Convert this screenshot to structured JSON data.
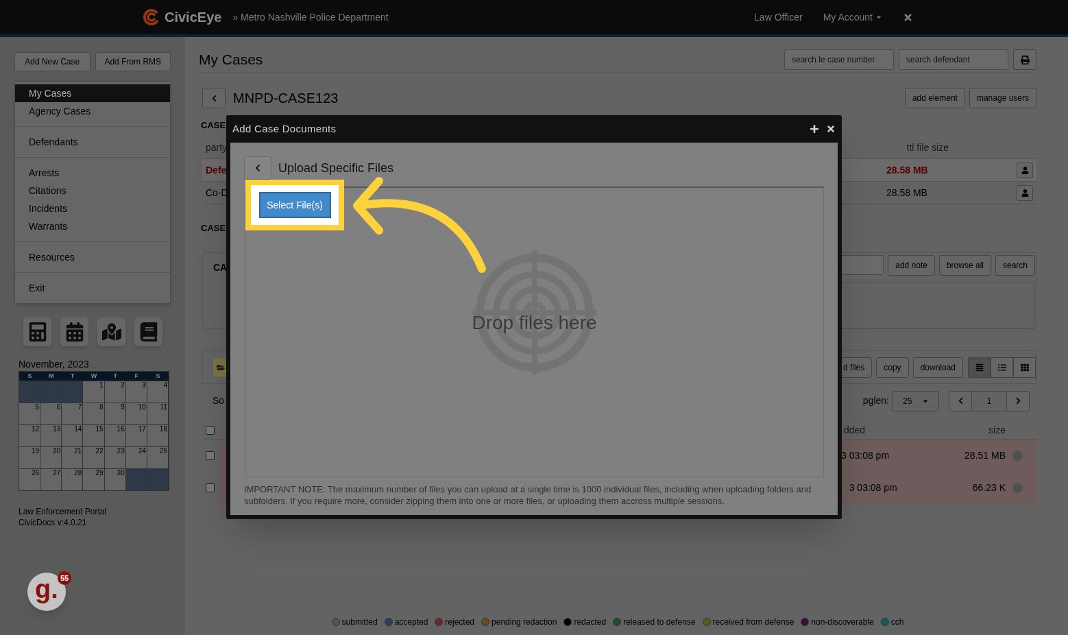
{
  "nav": {
    "brand": "CivicEye",
    "agency": "» Metro Nashville Police Department",
    "links": [
      {
        "label": "Law Officer",
        "kind": "link"
      },
      {
        "label": "My Account",
        "kind": "dropdown"
      }
    ]
  },
  "sidebar": {
    "buttons": [
      "Add New Case",
      "Add From RMS"
    ],
    "menu": [
      {
        "items": [
          {
            "label": "My Cases",
            "selected": true
          },
          {
            "label": "Agency Cases",
            "selected": false
          }
        ]
      },
      {
        "items": [
          {
            "label": "Defendants",
            "selected": false
          }
        ]
      },
      {
        "items": [
          {
            "label": "Arrests",
            "selected": false
          },
          {
            "label": "Citations",
            "selected": false
          },
          {
            "label": "Incidents",
            "selected": false
          },
          {
            "label": "Warrants",
            "selected": false
          }
        ]
      },
      {
        "items": [
          {
            "label": "Resources",
            "selected": false
          }
        ]
      },
      {
        "items": [
          {
            "label": "Exit",
            "selected": false
          }
        ]
      }
    ]
  },
  "calendar": {
    "title": "November, 2023",
    "weekdays": [
      "S",
      "M",
      "T",
      "W",
      "T",
      "F",
      "S"
    ],
    "weeks": [
      [
        {
          "kind": "blank"
        },
        {
          "kind": "blank"
        },
        {
          "kind": "blank"
        },
        {
          "kind": "day",
          "label": "1"
        },
        {
          "kind": "day",
          "label": "2"
        },
        {
          "kind": "day",
          "label": "3"
        },
        {
          "kind": "day",
          "label": "4"
        }
      ],
      [
        {
          "kind": "day",
          "label": "5"
        },
        {
          "kind": "day",
          "label": "6"
        },
        {
          "kind": "day",
          "label": "7"
        },
        {
          "kind": "day",
          "label": "8"
        },
        {
          "kind": "day",
          "label": "9"
        },
        {
          "kind": "day",
          "label": "10"
        },
        {
          "kind": "day",
          "label": "11"
        }
      ],
      [
        {
          "kind": "day",
          "label": "12"
        },
        {
          "kind": "day",
          "label": "13"
        },
        {
          "kind": "day",
          "label": "14"
        },
        {
          "kind": "day",
          "label": "15"
        },
        {
          "kind": "day",
          "label": "16"
        },
        {
          "kind": "day",
          "label": "17"
        },
        {
          "kind": "day",
          "label": "18"
        }
      ],
      [
        {
          "kind": "day",
          "label": "19"
        },
        {
          "kind": "day",
          "label": "20"
        },
        {
          "kind": "day",
          "label": "21"
        },
        {
          "kind": "day",
          "label": "22"
        },
        {
          "kind": "day",
          "label": "23"
        },
        {
          "kind": "day",
          "label": "24"
        },
        {
          "kind": "day",
          "label": "25"
        }
      ],
      [
        {
          "kind": "day",
          "label": "26"
        },
        {
          "kind": "day",
          "label": "27"
        },
        {
          "kind": "day",
          "label": "28"
        },
        {
          "kind": "day",
          "label": "29"
        },
        {
          "kind": "day",
          "label": "30"
        },
        {
          "kind": "blank"
        },
        {
          "kind": "blank"
        }
      ]
    ]
  },
  "about": [
    "Law Enforcement Portal",
    "CivicDocs v:4.0.21"
  ],
  "chat_badge": {
    "logo": "g.",
    "count": "55"
  },
  "page": {
    "title": "My Cases",
    "search_fields": [
      {
        "placeholder": "search le case number"
      },
      {
        "placeholder": "search defendant"
      }
    ],
    "case": {
      "number": "MNPD-CASE123",
      "actions": [
        "add element",
        "manage users"
      ]
    },
    "parties": {
      "heading": "CASE",
      "columns": [
        "party",
        "ttl file size"
      ],
      "rows": [
        {
          "party": "Defe",
          "size": "28.58 MB",
          "highlighted": true
        },
        {
          "party": "Co-D",
          "size": "28.58 MB",
          "highlighted": false
        }
      ]
    },
    "notes": {
      "heading": "CASE",
      "panel_title": "CA",
      "actions": [
        "add note",
        "browse all",
        "search"
      ]
    },
    "files": {
      "actions": [
        "d files",
        "copy",
        "download"
      ],
      "views": [
        {
          "kind": "detail",
          "selected": true
        },
        {
          "kind": "list",
          "selected": false
        },
        {
          "kind": "grid",
          "selected": false
        }
      ],
      "sort_label": "So",
      "page_length_label": "pglen:",
      "page_length": "25",
      "page": "1",
      "all_checked": false,
      "columns": [
        "dded",
        "size"
      ],
      "rows": [
        {
          "added": "3 03:08 pm",
          "size": "28.51 MB",
          "checked": false
        },
        {
          "added": "3 03:08 pm",
          "size": "66.23 K",
          "checked": false
        }
      ]
    }
  },
  "legend": [
    {
      "label": "submitted",
      "color": "#555555"
    },
    {
      "label": "accepted",
      "color": "#2c3d66"
    },
    {
      "label": "rejected",
      "color": "#6b2626"
    },
    {
      "label": "pending redaction",
      "color": "#6b4a1c"
    },
    {
      "label": "redacted",
      "color": "#000000"
    },
    {
      "label": "released to defense",
      "color": "#1e4d2b"
    },
    {
      "label": "received from defense",
      "color": "#5c5a1e"
    },
    {
      "label": "non-discoverable",
      "color": "#3d0d3d"
    },
    {
      "label": "cch",
      "color": "#17585a"
    }
  ],
  "modal": {
    "title": "Add Case Documents",
    "heading": "Upload Specific Files",
    "button": "Select File(s)",
    "drop_hint": "Drop files here",
    "note": "IMPORTANT NOTE: The maximum number of files you can upload at a single time is 1000 individual files, including when uploading folders and subfolders. If you require more, consider zipping them into one or more files, or uploading them accross multiple sessions."
  }
}
